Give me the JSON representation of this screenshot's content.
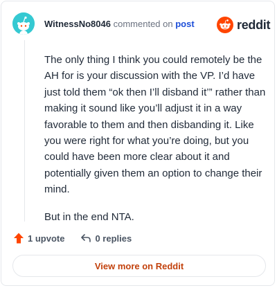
{
  "header": {
    "username": "WitnessNo8046",
    "commented_on": "commented on",
    "post_link": "post"
  },
  "logo": {
    "text": "reddit",
    "icon": "reddit-snoo-icon",
    "brand_color": "#ff4500"
  },
  "comment": {
    "paragraphs": [
      "The only thing I think you could remotely be the AH for is your discussion with the VP. I’d have just told them “ok then I’ll disband it’” rather than making it sound like you’ll adjust it in a way favorable to them and then disbanding it. Like you were right for what you’re doing, but you could have been more clear about it and potentially given them an option to change their mind.",
      "But in the end NTA."
    ]
  },
  "actions": {
    "upvote_label": "1 upvote",
    "upvote_icon": "upvote-arrow-icon",
    "replies_label": "0 replies",
    "replies_icon": "reply-arrow-icon"
  },
  "view_more": {
    "label": "View more on Reddit"
  },
  "colors": {
    "accent": "#ff4500",
    "link": "#1d4ed8",
    "avatar_bg": "#35c9d2"
  }
}
